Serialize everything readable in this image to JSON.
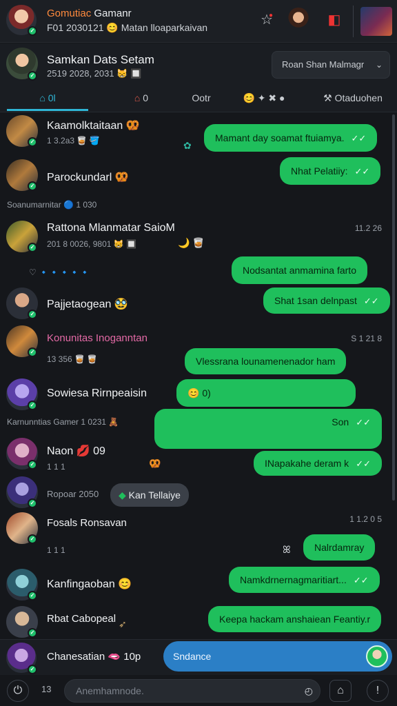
{
  "header": {
    "title_accent": "Gomutiac",
    "title_rest": "Gamanr",
    "subtitle_left": "F01 2030121",
    "subtitle_emoji": "😊",
    "subtitle_right": "Matan lloaparkaivan",
    "icons": [
      "star-icon",
      "profile-avatar",
      "notification-icon",
      "group-avatar"
    ]
  },
  "chat_info": {
    "name": "Samkan Dats Setam",
    "meta": "2519 2028, 2031 😸 🔲",
    "dropdown_label": "Roan Shan Malmagr"
  },
  "tabs": [
    {
      "label": "0l",
      "icon": "home-icon",
      "active": true
    },
    {
      "label": "0",
      "icon": "house-icon",
      "active": false
    },
    {
      "label": "Ootr",
      "active": false
    },
    {
      "label": "😊 ✦ ✖ ●",
      "active": false
    },
    {
      "label": "Otaduohen",
      "icon": "tools-icon",
      "active": false
    }
  ],
  "rows": [
    {
      "name": "Kaamolktaitaan 🥨",
      "meta": "1 3.2a3 🥃 🪣",
      "bubble": "Mamant day soamat ftuiamya.",
      "tick": "✓✓"
    },
    {
      "name": "Parockundarl 🥨",
      "bubble": "Nhat Pelatiiy:",
      "tick": "✓✓"
    },
    {
      "system": "Soanumarnitar 🔵 1 030"
    },
    {
      "name": "Rattona Mlanmatar SaioM",
      "meta": "201 8 0026, 9801 😸 🔲",
      "time": "11.2 26",
      "extra": "🌙 🥃"
    },
    {
      "system": "♡ 🔹🔹🔹🔹🔹",
      "bubble": "Nodsantat anmamina farto"
    },
    {
      "name": "Pajjetaogean 🥸",
      "bubble": "Shat 1san delnpast",
      "tick": "✓✓"
    },
    {
      "name": "Konunitas Inoganntan",
      "meta": "13 356 🥃 🥃",
      "time": "S 1 21 8",
      "bubble": "Vlessrana lounamenenador ham"
    },
    {
      "name": "Sowiesa Rirnpeaisin",
      "bubble": "😊 0)"
    },
    {
      "system": "Karnunntias Gamer 1 0231 🧸",
      "bubble": "Son",
      "tick": "✓✓"
    },
    {
      "name": "Naon 💋 09",
      "meta": "1 1 1",
      "bubble": "INapakahe deram k",
      "tick": "✓✓"
    },
    {
      "name": "Ropoar 2050",
      "pill": "Kan Tellaiye"
    },
    {
      "name": "Fosals Ronsavan",
      "meta": "1 1 1",
      "time": "1 1.2 0 5",
      "bubble": "Nalrdamray"
    },
    {
      "name": "Kanfingaoban 😊",
      "bubble": "Namkdrnernagmaritiart...",
      "tick": "✓✓"
    },
    {
      "name": "Rbat Cabopeal",
      "bubble": "Keepa hackam anshaiean Feantiy.r"
    }
  ],
  "quick": {
    "name": "Chanesatian 🫦 10p",
    "send_label": "Sndance"
  },
  "composer": {
    "placeholder": "Anemhamnode.",
    "counter": "13"
  },
  "colors": {
    "accent_green": "#1fbf5c",
    "tab_active": "#2fb6d6",
    "send_blue": "#2b7fc6",
    "title_orange": "#ff8a3d",
    "pink_name": "#e46aa6"
  }
}
